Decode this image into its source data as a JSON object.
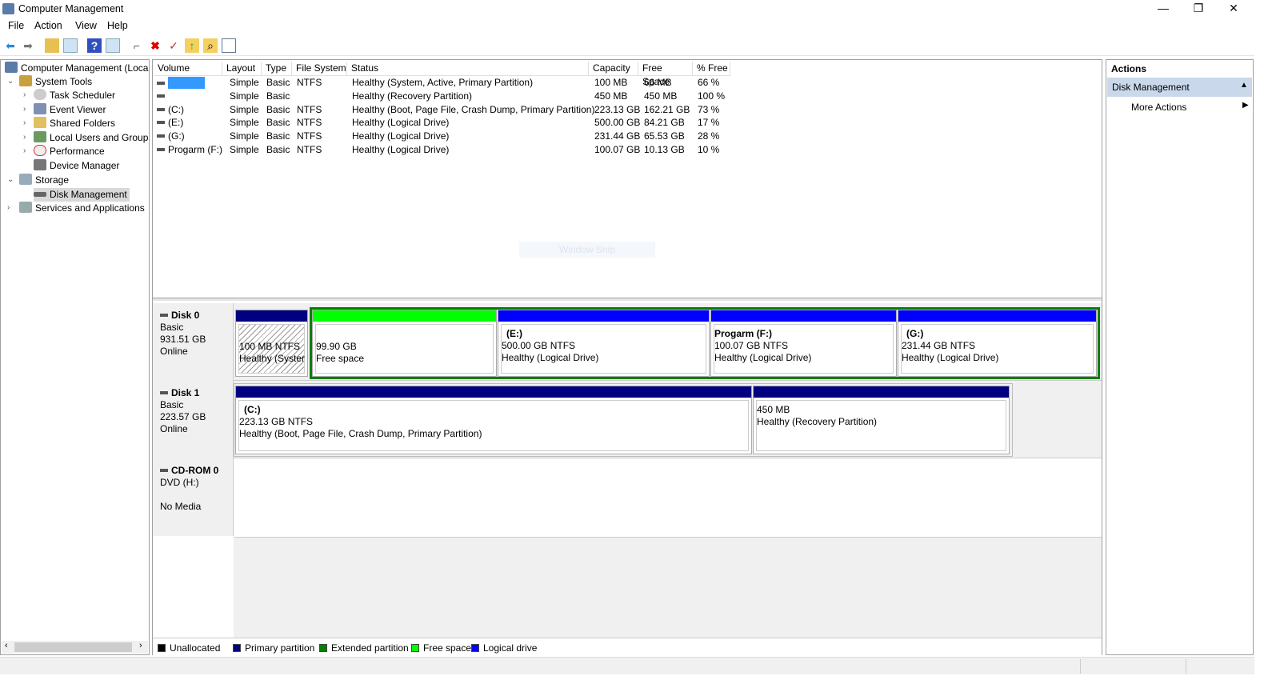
{
  "window": {
    "title": "Computer Management",
    "minimize": "—",
    "restore": "❐",
    "close": "✕"
  },
  "menu": [
    "File",
    "Action",
    "View",
    "Help"
  ],
  "toolbar": [
    "back-icon",
    "forward-icon",
    "up-folder-icon",
    "show-hide-tree-icon",
    "help-icon",
    "show-hide-action-pane-icon",
    "connect-icon",
    "delete-icon",
    "properties-icon",
    "export-icon",
    "search-icon",
    "console-icon"
  ],
  "tree": [
    {
      "label": "Computer Management (Local",
      "icon": "computer-management-icon"
    },
    {
      "label": "System Tools",
      "icon": "tools-icon"
    },
    {
      "label": "Task Scheduler",
      "icon": "clock-icon"
    },
    {
      "label": "Event Viewer",
      "icon": "event-viewer-icon"
    },
    {
      "label": "Shared Folders",
      "icon": "shared-folder-icon"
    },
    {
      "label": "Local Users and Groups",
      "icon": "users-icon"
    },
    {
      "label": "Performance",
      "icon": "performance-icon"
    },
    {
      "label": "Device Manager",
      "icon": "device-manager-icon"
    },
    {
      "label": "Storage",
      "icon": "storage-icon"
    },
    {
      "label": "Disk Management",
      "icon": "disk-icon"
    },
    {
      "label": "Services and Applications",
      "icon": "services-icon"
    }
  ],
  "volumes": {
    "columns": [
      "Volume",
      "Layout",
      "Type",
      "File System",
      "Status",
      "Capacity",
      "Free Space",
      "% Free"
    ],
    "rows": [
      [
        "",
        "Simple",
        "Basic",
        "NTFS",
        "Healthy (System, Active, Primary Partition)",
        "100 MB",
        "66 MB",
        "66 %"
      ],
      [
        "",
        "Simple",
        "Basic",
        "",
        "Healthy (Recovery Partition)",
        "450 MB",
        "450 MB",
        "100 %"
      ],
      [
        "(C:)",
        "Simple",
        "Basic",
        "NTFS",
        "Healthy (Boot, Page File, Crash Dump, Primary Partition)",
        "223.13 GB",
        "162.21 GB",
        "73 %"
      ],
      [
        "(E:)",
        "Simple",
        "Basic",
        "NTFS",
        "Healthy (Logical Drive)",
        "500.00 GB",
        "84.21 GB",
        "17 %"
      ],
      [
        "(G:)",
        "Simple",
        "Basic",
        "NTFS",
        "Healthy (Logical Drive)",
        "231.44 GB",
        "65.53 GB",
        "28 %"
      ],
      [
        "Progarm (F:)",
        "Simple",
        "Basic",
        "NTFS",
        "Healthy (Logical Drive)",
        "100.07 GB",
        "10.13 GB",
        "10 %"
      ]
    ]
  },
  "disks": [
    {
      "name": "Disk 0",
      "type": "Basic",
      "size": "931.51 GB",
      "state": "Online",
      "partitions": [
        {
          "label": "",
          "line1": "100 MB NTFS",
          "line2": "Healthy (Syster"
        },
        {
          "label": "",
          "line1": "99.90 GB",
          "line2": "Free space"
        },
        {
          "label": "(E:)",
          "line1": "500.00 GB NTFS",
          "line2": "Healthy (Logical Drive)"
        },
        {
          "label": "Progarm  (F:)",
          "line1": "100.07 GB NTFS",
          "line2": "Healthy (Logical Drive)"
        },
        {
          "label": "(G:)",
          "line1": "231.44 GB NTFS",
          "line2": "Healthy (Logical Drive)"
        }
      ]
    },
    {
      "name": "Disk 1",
      "type": "Basic",
      "size": "223.57 GB",
      "state": "Online",
      "partitions": [
        {
          "label": "(C:)",
          "line1": "223.13 GB NTFS",
          "line2": "Healthy (Boot, Page File, Crash Dump, Primary Partition)"
        },
        {
          "label": "",
          "line1": "450 MB",
          "line2": "Healthy (Recovery Partition)"
        }
      ]
    },
    {
      "name": "CD-ROM 0",
      "type": "DVD (H:)",
      "size": "",
      "state": "No Media",
      "partitions": []
    }
  ],
  "legend": [
    {
      "label": "Unallocated",
      "color": "#000000"
    },
    {
      "label": "Primary partition",
      "color": "#000080"
    },
    {
      "label": "Extended partition",
      "color": "#008000"
    },
    {
      "label": "Free space",
      "color": "#00ff00"
    },
    {
      "label": "Logical drive",
      "color": "#0000ff"
    }
  ],
  "actions": {
    "title": "Actions",
    "section": "Disk Management",
    "more": "More Actions"
  },
  "watermark": "Window Snip"
}
